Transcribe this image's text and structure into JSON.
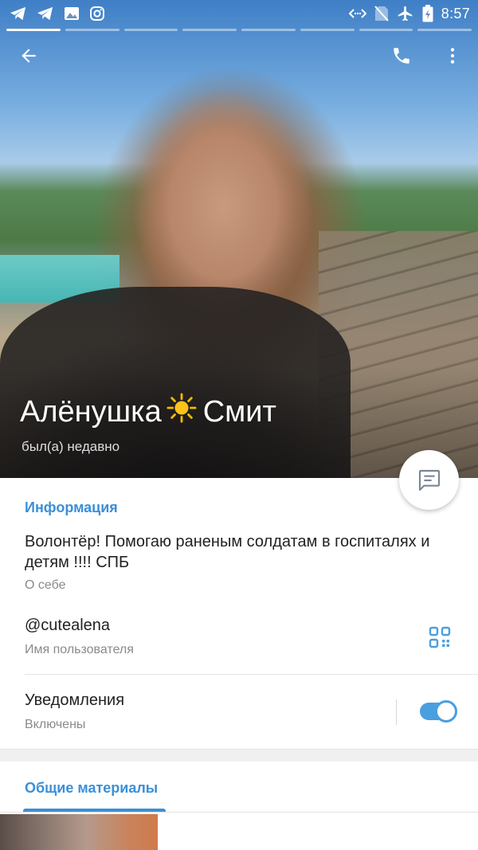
{
  "status_bar": {
    "time": "8:57",
    "icons": [
      "telegram-icon",
      "telegram-icon",
      "gallery-icon",
      "instagram-icon",
      "data-sync-icon",
      "no-sim-icon",
      "airplane-mode-icon",
      "battery-charging-icon"
    ]
  },
  "header": {
    "name_first": "Алёнушка",
    "name_emoji": "sun-emoji-icon",
    "name_last": "Смит",
    "status": "был(а) недавно",
    "actions": [
      "back-arrow-icon",
      "phone-icon",
      "more-vertical-icon"
    ]
  },
  "fab": {
    "icon": "message-icon"
  },
  "info": {
    "title": "Информация",
    "bio": "Волонтёр! Помогаю раненым солдатам в госпиталях и детям !!!! СПБ",
    "bio_label": "О себе",
    "username": "@cutealena",
    "username_label": "Имя пользователя",
    "notifications": "Уведомления",
    "notifications_state": "Включены",
    "notifications_on": true
  },
  "media": {
    "title": "Общие материалы"
  },
  "colors": {
    "accent": "#3a8fd8",
    "toggle": "#4a9fdf",
    "secondary_text": "#8a8a8a"
  }
}
